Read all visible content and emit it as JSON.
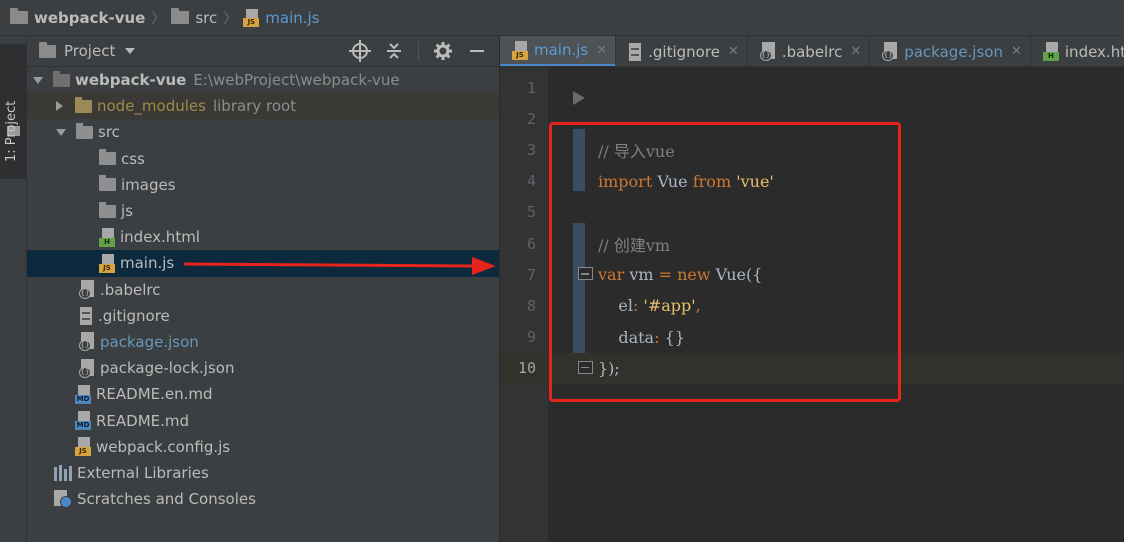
{
  "breadcrumb": {
    "items": [
      {
        "label": "webpack-vue",
        "icon": "folder-icon"
      },
      {
        "label": "src",
        "icon": "folder-icon"
      },
      {
        "label": "main.js",
        "icon": "js-file-icon"
      }
    ]
  },
  "toolstrip": {
    "project_tab_label": "1: Project"
  },
  "project_panel": {
    "title": "Project",
    "tools": [
      "locate-icon",
      "collapse-icon",
      "settings-icon",
      "hide-icon"
    ]
  },
  "tree": {
    "root": {
      "name": "webpack-vue",
      "path": "E:\\webProject\\webpack-vue"
    },
    "node_modules": {
      "name": "node_modules",
      "hint": "library root"
    },
    "src": {
      "name": "src"
    },
    "css": {
      "name": "css"
    },
    "images": {
      "name": "images"
    },
    "js": {
      "name": "js"
    },
    "index_html": {
      "name": "index.html"
    },
    "main_js": {
      "name": "main.js"
    },
    "babelrc": {
      "name": ".babelrc"
    },
    "gitignore": {
      "name": ".gitignore"
    },
    "package_json": {
      "name": "package.json"
    },
    "package_lock": {
      "name": "package-lock.json"
    },
    "readme_en": {
      "name": "README.en.md"
    },
    "readme": {
      "name": "README.md"
    },
    "webpack_config": {
      "name": "webpack.config.js"
    },
    "external_libraries": {
      "name": "External Libraries"
    },
    "scratches": {
      "name": "Scratches and Consoles"
    }
  },
  "tabs": [
    {
      "label": "main.js",
      "active": true
    },
    {
      "label": ".gitignore",
      "active": false
    },
    {
      "label": ".babelrc",
      "active": false
    },
    {
      "label": "package.json",
      "active": false
    },
    {
      "label": "index.htm",
      "active": false
    }
  ],
  "editor": {
    "line_numbers": [
      "1",
      "2",
      "3",
      "4",
      "5",
      "6",
      "7",
      "8",
      "9",
      "10"
    ],
    "current_line": 10,
    "code": {
      "l3_comment": "// 导入vue",
      "l4_import": "import",
      "l4_vue": " Vue ",
      "l4_from": "from",
      "l4_str": " 'vue'",
      "l6_comment": "// 创建vm",
      "l7_var": "var",
      "l7_vm": " vm ",
      "l7_eq": "=",
      "l7_new": " new",
      "l7_vue": " Vue({",
      "l8_key": "    el",
      "l8_colon": ":",
      "l8_str": " '#app'",
      "l8_comma": ",",
      "l9_key": "    data",
      "l9_colon": ":",
      "l9_val": " {}",
      "l10_close": "});"
    }
  },
  "colors": {
    "accent": "#4a88c7",
    "annotation_red": "#e8231b"
  }
}
